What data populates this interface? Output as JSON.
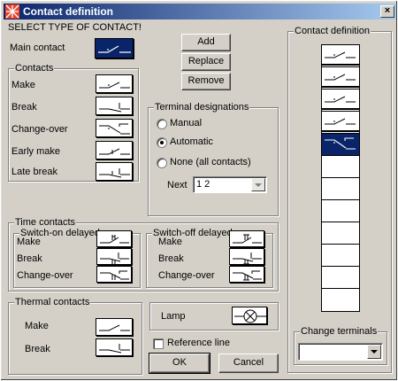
{
  "window": {
    "title": "Contact definition",
    "close_glyph": "×"
  },
  "header_text": "SELECT TYPE OF CONTACT!",
  "main_contact": {
    "label": "Main contact"
  },
  "buttons": {
    "add": "Add",
    "replace": "Replace",
    "remove": "Remove",
    "ok": "OK",
    "cancel": "Cancel"
  },
  "contacts": {
    "legend": "Contacts",
    "items": [
      {
        "label": "Make"
      },
      {
        "label": "Break"
      },
      {
        "label": "Change-over"
      },
      {
        "label": "Early make"
      },
      {
        "label": "Late break"
      }
    ]
  },
  "terminal": {
    "legend": "Terminal designations",
    "options": [
      "Manual",
      "Automatic",
      "None (all contacts)"
    ],
    "selected_index": 1,
    "next_label": "Next",
    "next_value": "1 2"
  },
  "time_contacts": {
    "legend": "Time contacts",
    "on": {
      "legend": "Switch-on delayed",
      "items": [
        "Make",
        "Break",
        "Change-over"
      ]
    },
    "off": {
      "legend": "Switch-off delayed",
      "items": [
        "Make",
        "Break",
        "Change-over"
      ]
    }
  },
  "thermal": {
    "legend": "Thermal contacts",
    "items": [
      "Make",
      "Break"
    ]
  },
  "lamp": {
    "label": "Lamp"
  },
  "reference_line": {
    "label": "Reference line",
    "checked": false
  },
  "contact_def": {
    "legend": "Contact definition",
    "filled": 5,
    "selected_index": 4,
    "total": 12
  },
  "change_terminals": {
    "legend": "Change terminals",
    "value": ""
  },
  "colors": {
    "selection": "#0a246a",
    "face": "#d4d0c8",
    "title_start": "#0a246a",
    "title_end": "#a6caf0"
  },
  "icons": {
    "app": "contact-app-icon",
    "lamp": "lamp-icon",
    "dropdown": "chevron-down-icon"
  }
}
